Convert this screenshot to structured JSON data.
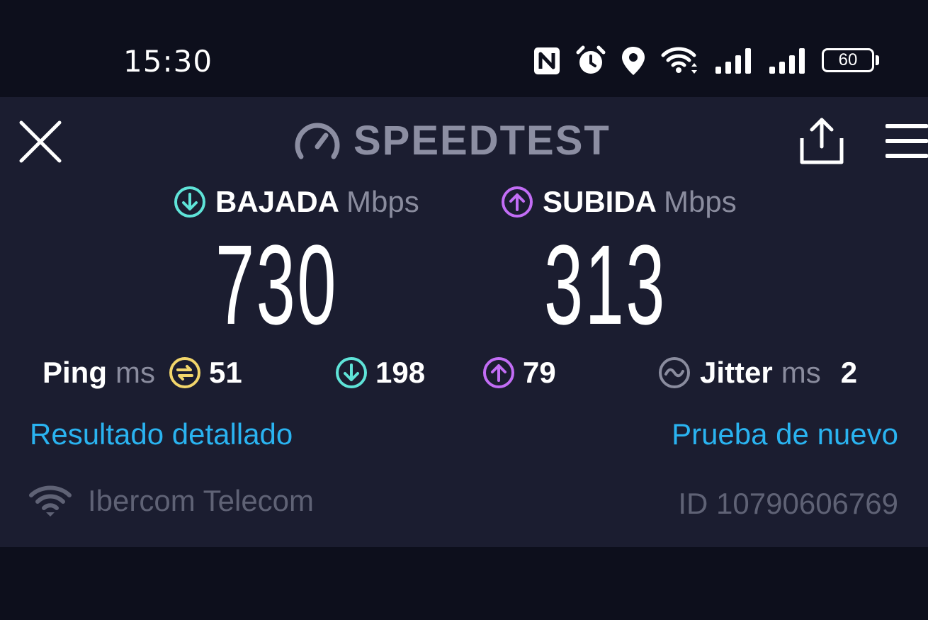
{
  "status_bar": {
    "time": "15:30",
    "battery": "60",
    "icons": [
      "nfc-icon",
      "alarm-icon",
      "location-icon",
      "wifi-icon",
      "signal-icon",
      "signal-icon",
      "battery-icon"
    ]
  },
  "header": {
    "title": "SPEEDTEST",
    "icons": [
      "close-icon",
      "speedometer-icon",
      "share-icon",
      "menu-icon"
    ]
  },
  "download": {
    "label": "BAJADA",
    "unit": "Mbps",
    "value": "730"
  },
  "upload": {
    "label": "SUBIDA",
    "unit": "Mbps",
    "value": "313"
  },
  "ping": {
    "label": "Ping",
    "unit": "ms",
    "idle": "51",
    "download": "198",
    "upload": "79"
  },
  "jitter": {
    "label": "Jitter",
    "unit": "ms",
    "value": "2"
  },
  "actions": {
    "detailed_result": "Resultado detallado",
    "test_again": "Prueba de nuevo"
  },
  "footer": {
    "provider": "Ibercom Telecom",
    "result_id": "ID 10790606769"
  },
  "colors": {
    "background": "#0d0f1c",
    "panel": "#1b1d30",
    "download_accent": "#5fe3d8",
    "upload_accent": "#c26df5",
    "ping_accent": "#f2d66b",
    "link": "#2ab3f0",
    "muted": "#8a8c9e"
  }
}
